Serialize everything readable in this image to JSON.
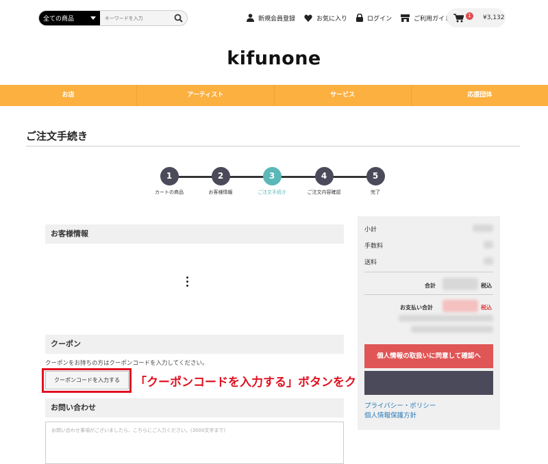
{
  "header": {
    "category": "全ての商品",
    "search_placeholder": "キーワードを入力",
    "nav": [
      "新規会員登録",
      "お気に入り",
      "ログイン",
      "ご利用ガイド"
    ],
    "cart_count": "1",
    "cart_total": "¥3,132"
  },
  "logo": "kifunone",
  "menu": [
    "お店",
    "アーティスト",
    "サービス",
    "応援団体"
  ],
  "page_title": "ご注文手続き",
  "steps": [
    {
      "num": "1",
      "label": "カートの商品"
    },
    {
      "num": "2",
      "label": "お客様情報"
    },
    {
      "num": "3",
      "label": "ご注文手続き"
    },
    {
      "num": "4",
      "label": "ご注文内容確認"
    },
    {
      "num": "5",
      "label": "完了"
    }
  ],
  "active_step": 3,
  "sections": {
    "customer": "お客様情報",
    "coupon": "クーポン",
    "inquiry": "お問い合わせ"
  },
  "coupon": {
    "description": "クーポンをお持ちの方はクーポンコードを入力してください。",
    "button": "クーポンコードを入力する"
  },
  "inquiry_placeholder": "お問い合わせ事項がございましたら、こちらにご入力ください。(3000文字まで)",
  "annotation": "「クーポンコードを入力する」ボタンをクリック",
  "summary": {
    "subtotal": "小計",
    "fee": "手数料",
    "shipping": "送料",
    "total": "合計",
    "tax_incl": "税込",
    "payment_total": "お支払い合計",
    "tax_incl2": "税込",
    "consent_button": "個人情報の取扱いに同意して確認へ",
    "privacy": "プライバシー・ポリシー",
    "protection": "個人情報保護方針"
  },
  "colors": {
    "accent_orange": "#fbb040",
    "step_active": "#5bb8b8",
    "consent_red": "#e05555",
    "annotation_red": "#e01020"
  }
}
